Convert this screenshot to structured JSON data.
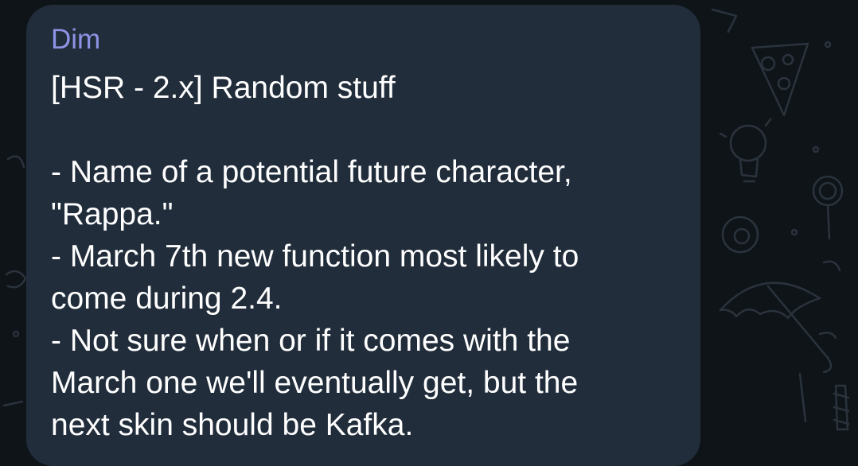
{
  "message": {
    "sender": "Dim",
    "sender_color": "#8f93e6",
    "bubble_color": "#212d3b",
    "lines": [
      "[HSR - 2.x] Random stuff",
      "",
      "- Name of a potential future character,",
      "\"Rappa.\"",
      "- March 7th new function most likely to",
      "come during 2.4.",
      "- Not sure when or if it comes with the",
      "March one we'll eventually get, but the",
      "next skin should be Kafka."
    ]
  },
  "background": {
    "color": "#0f1419",
    "doodle_icons": [
      "pizza-icon",
      "lightbulb-icon",
      "lollipop-icon",
      "billiard-ball-icon",
      "umbrella-icon",
      "candy-icon"
    ]
  }
}
